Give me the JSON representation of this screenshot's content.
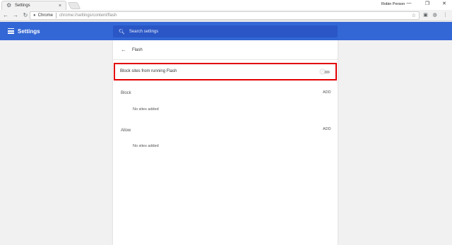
{
  "browser": {
    "tab_title": "Settings",
    "tab_favicon": "gear-icon",
    "tab_close": "×",
    "profile_name": "Robin Person",
    "window_controls": [
      "—",
      "❐",
      "✕"
    ],
    "omnibox": {
      "site_label": "Chrome",
      "url": "chrome://settings/content/flash"
    }
  },
  "header": {
    "title": "Settings",
    "search_placeholder": "Search settings"
  },
  "page": {
    "title": "Flash",
    "toggle_label": "Block sites from running Flash",
    "toggle_on": false,
    "sections": [
      {
        "label": "Block",
        "add_label": "ADD",
        "empty_text": "No sites added"
      },
      {
        "label": "Allow",
        "add_label": "ADD",
        "empty_text": "No sites added"
      }
    ]
  },
  "colors": {
    "header_blue": "#3367d6",
    "search_blue": "#2a56c6",
    "highlight_red": "#e30000"
  }
}
